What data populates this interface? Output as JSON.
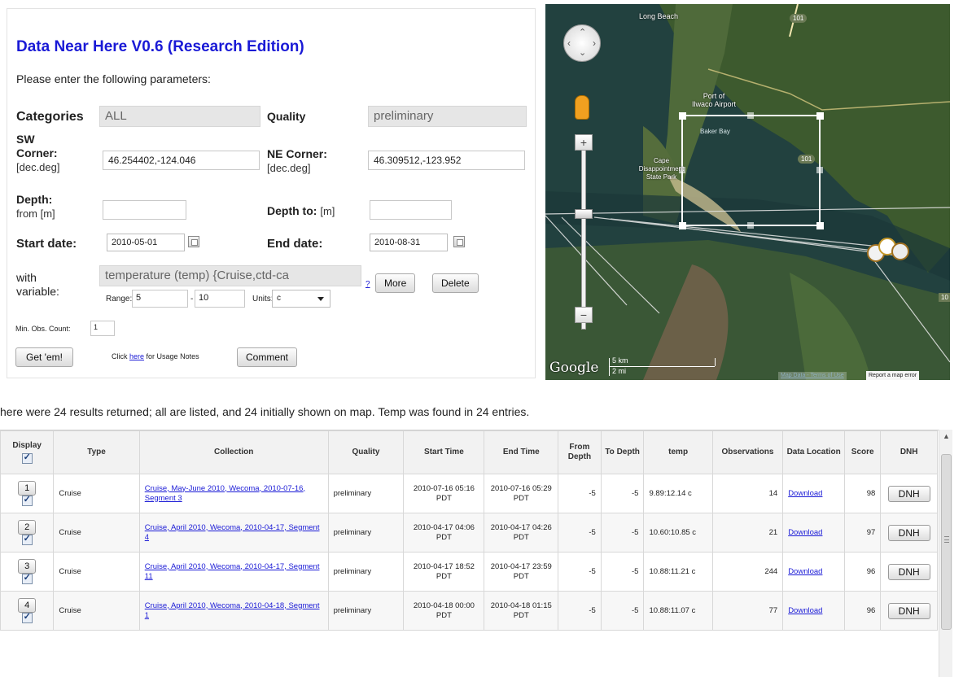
{
  "app": {
    "title": "Data Near Here V0.6 (Research Edition)",
    "intro": "Please enter the following parameters:"
  },
  "form": {
    "categories_label": "Categories",
    "categories_value": "ALL",
    "quality_label": "Quality",
    "quality_value": "preliminary",
    "sw_label_line1": "SW",
    "sw_label_line2": "Corner:",
    "sw_unit": "[dec.deg]",
    "sw_value": "46.254402,-124.046",
    "ne_label": "NE Corner:",
    "ne_unit": "[dec.deg]",
    "ne_value": "46.309512,-123.952",
    "depth_label": "Depth:",
    "depth_unit": "from [m]",
    "depth_from_value": "",
    "depth_to_label": "Depth to:",
    "depth_to_unit": "[m]",
    "depth_to_value": "",
    "start_label": "Start date:",
    "start_value": "2010-05-01",
    "end_label": "End date:",
    "end_value": "2010-08-31",
    "with_label": "with",
    "variable_label": "variable:",
    "variable_value": "temperature (temp) {Cruise,ctd-ca",
    "range_label": "Range:",
    "range_from": "5",
    "range_dash": "-",
    "range_to": "10",
    "units_label": "Units:",
    "units_value": "c",
    "help_link": "?",
    "more_button": "More",
    "delete_button": "Delete",
    "min_obs_label": "Min. Obs. Count:",
    "min_obs_value": "1",
    "get_button": "Get 'em!",
    "usage_prefix": "Click",
    "usage_link": "here",
    "usage_suffix": "for Usage Notes",
    "comment_button": "Comment"
  },
  "map": {
    "labels": {
      "long_beach": "Long Beach",
      "port_of_ilwaco": "Port of",
      "ilwaco_airport": "Ilwaco Airport",
      "baker_bay": "Baker Bay",
      "cape_disappointment": "Cape Disappointment State Park",
      "hwy_101": "101",
      "hwy_101b": "101",
      "hwy_10": "10"
    },
    "scale_km": "5 km",
    "scale_mi": "2 mi",
    "google_logo": "Google",
    "footer_terms": "Map Data - Terms of Use",
    "footer_report": "Report a map error"
  },
  "summary": "here were 24 results returned; all are listed, and 24 initially shown on map. Temp was found in 24 entries.",
  "table": {
    "headers": [
      "Display",
      "Type",
      "Collection",
      "Quality",
      "Start Time",
      "End Time",
      "From Depth",
      "To Depth",
      "temp",
      "Observations",
      "Data Location",
      "Score",
      "DNH"
    ],
    "rows": [
      {
        "num": "1",
        "type": "Cruise",
        "collection": "Cruise, May-June 2010, Wecoma, 2010-07-16, Segment 3",
        "quality": "preliminary",
        "start": "2010-07-16 05:16 PDT",
        "end": "2010-07-16 05:29 PDT",
        "from_depth": "-5",
        "to_depth": "-5",
        "temp": "9.89:12.14 c",
        "observations": "14",
        "location": "Download",
        "score": "98",
        "dnh": "DNH"
      },
      {
        "num": "2",
        "type": "Cruise",
        "collection": "Cruise, April 2010, Wecoma, 2010-04-17, Segment 4",
        "quality": "preliminary",
        "start": "2010-04-17 04:06 PDT",
        "end": "2010-04-17 04:26 PDT",
        "from_depth": "-5",
        "to_depth": "-5",
        "temp": "10.60:10.85 c",
        "observations": "21",
        "location": "Download",
        "score": "97",
        "dnh": "DNH"
      },
      {
        "num": "3",
        "type": "Cruise",
        "collection": "Cruise, April 2010, Wecoma, 2010-04-17, Segment 11",
        "quality": "preliminary",
        "start": "2010-04-17 18:52 PDT",
        "end": "2010-04-17 23:59 PDT",
        "from_depth": "-5",
        "to_depth": "-5",
        "temp": "10.88:11.21 c",
        "observations": "244",
        "location": "Download",
        "score": "96",
        "dnh": "DNH"
      },
      {
        "num": "4",
        "type": "Cruise",
        "collection": "Cruise, April 2010, Wecoma, 2010-04-18, Segment 1",
        "quality": "preliminary",
        "start": "2010-04-18 00:00 PDT",
        "end": "2010-04-18 01:15 PDT",
        "from_depth": "-5",
        "to_depth": "-5",
        "temp": "10.88:11.07 c",
        "observations": "77",
        "location": "Download",
        "score": "96",
        "dnh": "DNH"
      }
    ]
  }
}
